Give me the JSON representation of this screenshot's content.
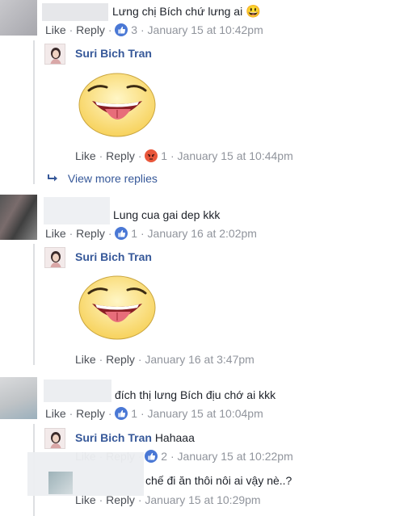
{
  "actions": {
    "like": "Like",
    "reply": "Reply",
    "sep": " · "
  },
  "view_more": "View more replies",
  "comments": [
    {
      "text": "Lưng chị Bích chứ lưng ai",
      "emoji": "😃",
      "reactions": "3",
      "time": "January 15 at 10:42pm",
      "reply": {
        "author": "Suri Bich Tran",
        "reaction_count": "1",
        "time": "January 15 at 10:44pm"
      }
    },
    {
      "text": "Lung cua gai dep kkk",
      "reactions": "1",
      "time": "January 16 at 2:02pm",
      "reply": {
        "author": "Suri Bich Tran",
        "time": "January 16 at 3:47pm"
      }
    },
    {
      "text": "đích thị lưng Bích địu chớ ai kkk",
      "reactions": "1",
      "time": "January 15 at 10:04pm",
      "replies": [
        {
          "author": "Suri Bich Tran",
          "text": "Hahaaa",
          "reactions": "2",
          "time": "January 15 at 10:22pm"
        },
        {
          "text": "chế đi ăn thôi nôi ai vậy nè..?",
          "time": "January 15 at 10:29pm"
        }
      ]
    }
  ],
  "colors": {
    "link": "#365899",
    "meta": "#90949c",
    "like": "#4a78d5",
    "angry": "#e9573b"
  }
}
